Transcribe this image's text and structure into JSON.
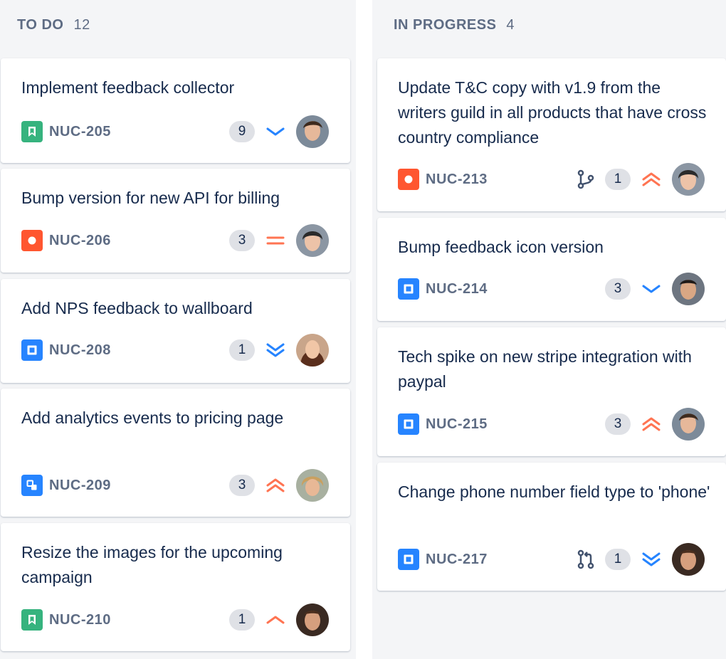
{
  "columns": [
    {
      "title": "TO DO",
      "count": "12",
      "cards": [
        {
          "summary": "Implement feedback collector",
          "key": "NUC-205",
          "type": "story-icon",
          "count": "9",
          "priority": "priority-low-icon",
          "branch": ""
        },
        {
          "summary": "Bump version for new API for billing",
          "key": "NUC-206",
          "type": "bug-icon",
          "count": "3",
          "priority": "priority-medium-icon",
          "branch": ""
        },
        {
          "summary": "Add NPS feedback to wallboard",
          "key": "NUC-208",
          "type": "task-icon",
          "count": "1",
          "priority": "priority-lowest-icon",
          "branch": ""
        },
        {
          "summary": "Add analytics events to pricing page",
          "key": "NUC-209",
          "type": "subtask-icon",
          "count": "3",
          "priority": "priority-highest-icon",
          "branch": ""
        },
        {
          "summary": "Resize the images for the upcoming campaign",
          "key": "NUC-210",
          "type": "story-icon",
          "count": "1",
          "priority": "priority-high-icon",
          "branch": ""
        }
      ]
    },
    {
      "title": "IN PROGRESS",
      "count": "4",
      "cards": [
        {
          "summary": "Update T&C copy with v1.9 from the writers guild in all products that have cross country compliance",
          "key": "NUC-213",
          "type": "bug-icon",
          "count": "1",
          "priority": "priority-highest-icon",
          "branch": "branch-icon"
        },
        {
          "summary": "Bump feedback icon version",
          "key": "NUC-214",
          "type": "task-icon",
          "count": "3",
          "priority": "priority-low-icon",
          "branch": ""
        },
        {
          "summary": "Tech spike on new stripe integration with paypal",
          "key": "NUC-215",
          "type": "task-icon",
          "count": "3",
          "priority": "priority-highest-icon",
          "branch": ""
        },
        {
          "summary": "Change phone number field type to 'phone'",
          "key": "NUC-217",
          "type": "task-icon",
          "count": "1",
          "priority": "priority-lowest-icon",
          "branch": "pull-request-icon"
        }
      ]
    }
  ],
  "colors": {
    "story": "#36b37e",
    "bug": "#ff5630",
    "task": "#2684ff",
    "priority_low": "#2684ff",
    "priority_high": "#ff7452",
    "column_bg": "#f4f5f7"
  }
}
